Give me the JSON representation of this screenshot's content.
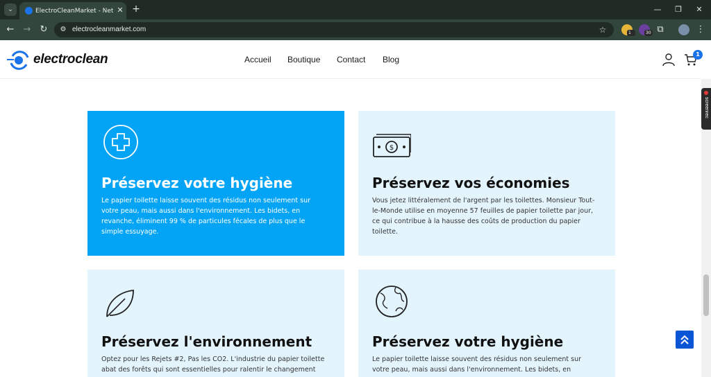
{
  "browser": {
    "tab_title": "ElectroCleanMarket - Nettoyage",
    "url": "electrocleanmarket.com",
    "extension_badges": [
      "1",
      "30"
    ]
  },
  "site": {
    "brand": "electroclean",
    "menu": [
      "Accueil",
      "Boutique",
      "Contact",
      "Blog"
    ],
    "cart_count": "1",
    "accent_color": "#03a4f5",
    "card_bg_light": "#e3f4fd"
  },
  "cards": [
    {
      "icon": "medical-cross-icon",
      "title": "Préservez votre hygiène",
      "lines": [
        "Le papier toilette laisse souvent des résidus non seulement sur",
        "votre peau, mais aussi dans l'environnement. Les bidets, en",
        "revanche, éliminent 99 % de particules fécales de plus que le",
        "simple essuyage."
      ]
    },
    {
      "icon": "banknote-icon",
      "title": "Préservez vos économies",
      "lines": [
        "Vous jetez littéralement de l'argent par les toilettes. Monsieur Tout-",
        "le-Monde utilise en moyenne 57 feuilles de papier toilette par jour,",
        "ce qui contribue à la hausse des coûts de production du papier",
        "toilette."
      ]
    },
    {
      "icon": "leaf-icon",
      "title": "Préservez l'environnement",
      "lines": [
        "Optez pour les Rejets #2, Pas les CO2. L'industrie du papier toilette",
        "abat des forêts qui sont essentielles pour ralentir le changement"
      ]
    },
    {
      "icon": "globe-icon",
      "title": "Préservez votre hygiène",
      "lines": [
        "Le papier toilette laisse souvent des résidus non seulement sur",
        "votre peau, mais aussi dans l'environnement. Les bidets, en"
      ]
    }
  ],
  "screenrec_label": "screenrec"
}
